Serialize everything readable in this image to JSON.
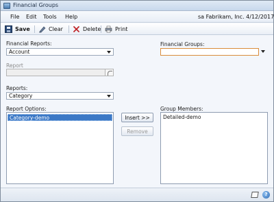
{
  "window": {
    "title": "Financial Groups"
  },
  "menu": {
    "file": "File",
    "edit": "Edit",
    "tools": "Tools",
    "help": "Help"
  },
  "status_info": "sa  Fabrikam, Inc.  4/12/2017",
  "toolbar": {
    "save": "Save",
    "clear": "Clear",
    "delete": "Delete",
    "print": "Print"
  },
  "form": {
    "financial_reports_label": "Financial Reports:",
    "financial_reports_value": "Account",
    "financial_groups_label": "Financial Groups:",
    "financial_groups_value": "",
    "report_label": "Report",
    "report_value": "",
    "reports_label": "Reports:",
    "reports_value": "Category",
    "report_options_label": "Report Options:",
    "report_options": [
      "Category-demo"
    ],
    "group_members_label": "Group Members:",
    "group_members": [
      "Detailed-demo"
    ],
    "insert_label": "Insert >>",
    "remove_label": "Remove"
  },
  "icons": {
    "save": "save-icon",
    "clear": "clear-icon",
    "delete": "delete-icon",
    "print": "print-icon",
    "note": "note-icon",
    "help": "help-icon"
  },
  "colors": {
    "selection": "#3b78c6",
    "dropdown_focus_border": "#d98c3a"
  }
}
